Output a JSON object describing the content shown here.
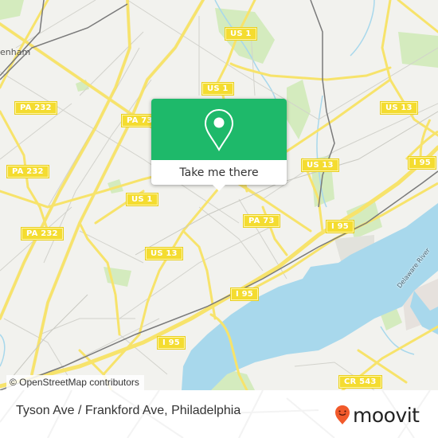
{
  "map": {
    "place_labels": [
      {
        "text": "enham"
      }
    ],
    "river_label": "Delaware River",
    "shields": [
      {
        "text": "US 1",
        "id": "us1-north"
      },
      {
        "text": "US 1",
        "id": "us1-mid"
      },
      {
        "text": "US 1",
        "id": "us1-west"
      },
      {
        "text": "PA 232",
        "id": "pa232-nw"
      },
      {
        "text": "PA 232",
        "id": "pa232-w"
      },
      {
        "text": "PA 232",
        "id": "pa232-sw"
      },
      {
        "text": "PA 73",
        "id": "pa73-north"
      },
      {
        "text": "PA 73",
        "id": "pa73-center"
      },
      {
        "text": "US 13",
        "id": "us13-ne"
      },
      {
        "text": "US 13",
        "id": "us13-east"
      },
      {
        "text": "US 13",
        "id": "us13-center"
      },
      {
        "text": "I 95",
        "id": "i95-ne"
      },
      {
        "text": "I 95",
        "id": "i95-east"
      },
      {
        "text": "I 95",
        "id": "i95-mid"
      },
      {
        "text": "I 95",
        "id": "i95-sw"
      },
      {
        "text": "CR 543",
        "id": "cr543"
      }
    ],
    "attribution": "© OpenStreetMap contributors",
    "colors": {
      "land": "#f2f2ee",
      "water": "#a8d8ec",
      "park": "#cfe8b7",
      "road_major": "#f7e36b",
      "road_minor": "#cfcfcf",
      "rail": "#777777"
    }
  },
  "popup": {
    "icon": "location-pin-icon",
    "button_label": "Take me there",
    "accent_color": "#1eb96a"
  },
  "footer": {
    "stop_name": "Tyson Ave / Frankford Ave, Philadelphia",
    "brand_name": "moovit",
    "brand_logo_color": "#f15a2b"
  }
}
